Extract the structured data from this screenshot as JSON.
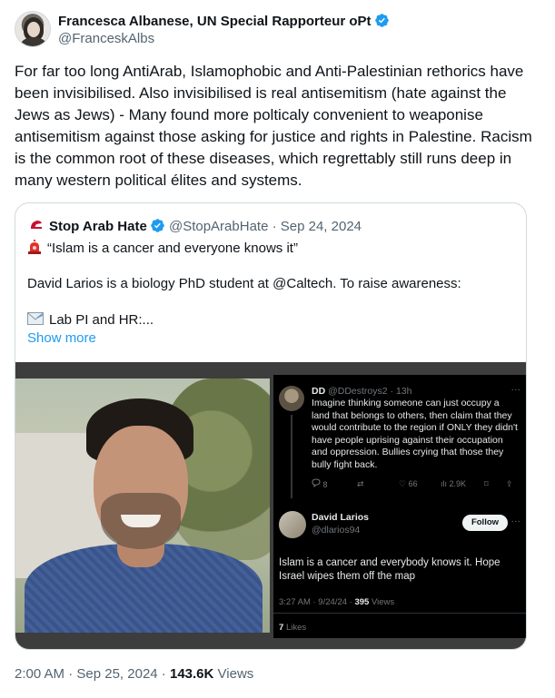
{
  "author": {
    "name": "Francesca Albanese, UN Special Rapporteur oPt",
    "handle": "@FranceskAlbs",
    "verified_icon": "verified-badge-icon",
    "accent_color": "#1d9bf0"
  },
  "tweet": {
    "text": "For far too long AntiArab, Islamophobic and Anti-Palestinian  rethorics have been invisibilised. Also invisibilised is real antisemitism (hate against the Jews as Jews) - Many found more polticaly convenient to weaponise antisemitism against those asking for justice and rights in Palestine. Racism is the common root of these diseases, which regrettably still runs deep in many western political élites and systems.",
    "time": "2:00 AM",
    "date": "Sep 25, 2024",
    "views_count": "143.6K",
    "views_label": "Views"
  },
  "quote": {
    "name": "Stop Arab Hate",
    "handle": "@StopArabHate",
    "date": "Sep 24, 2024",
    "line1": "“Islam is a cancer and everyone knows it”",
    "line2": "David Larios is a biology PhD student at @Caltech. To raise awareness:",
    "line3": "Lab PI and HR:...",
    "show_more": "Show more"
  },
  "screenshot": {
    "reply": {
      "name": "DD",
      "handle": "@DDestroys2",
      "time": "13h",
      "text": "Imagine thinking someone can just occupy a land that belongs to others, then claim that they would contribute to the region if ONLY they didn't have people uprising against their occupation and oppression. Bullies crying that those they bully fight back.",
      "replies": "8",
      "likes": "66",
      "views": "2.9K"
    },
    "post": {
      "name": "David Larios",
      "handle": "@dlarios94",
      "follow_label": "Follow",
      "text": "Islam is a cancer and everybody knows it. Hope Israel wipes them off the map",
      "time": "3:27 AM · 9/24/24 ·",
      "views_count": "395",
      "views_label": "Views",
      "likes_count": "7",
      "likes_label": "Likes"
    }
  }
}
